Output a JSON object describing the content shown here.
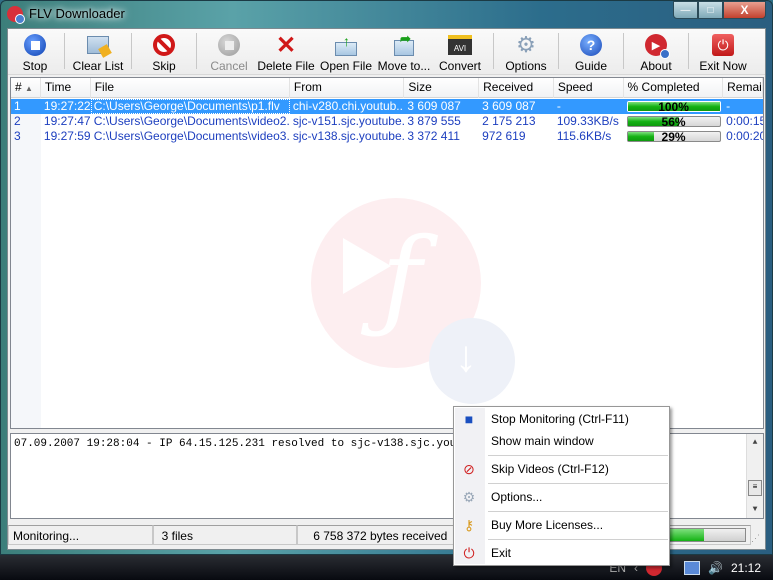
{
  "window": {
    "title": "FLV Downloader",
    "controls": {
      "minimize": "—",
      "maximize": "□",
      "close": "X"
    }
  },
  "toolbar": {
    "buttons": [
      {
        "label": "Stop",
        "icon": "stop-icon",
        "glyph": "■",
        "enabled": true
      },
      {
        "label": "Clear List",
        "icon": "clear-list-icon",
        "glyph": "☰",
        "enabled": true
      },
      {
        "label": "Skip",
        "icon": "skip-icon",
        "glyph": "⊘",
        "enabled": true
      },
      {
        "label": "Cancel",
        "icon": "cancel-icon",
        "glyph": "■",
        "enabled": false
      },
      {
        "label": "Delete File",
        "icon": "delete-file-icon",
        "glyph": "✖",
        "enabled": true
      },
      {
        "label": "Open File",
        "icon": "open-file-icon",
        "glyph": "↑",
        "enabled": true
      },
      {
        "label": "Move to...",
        "icon": "move-to-icon",
        "glyph": "↗",
        "enabled": true
      },
      {
        "label": "Convert",
        "icon": "convert-avi-icon",
        "glyph": "AVI",
        "enabled": true
      },
      {
        "label": "Options",
        "icon": "options-gear-icon",
        "glyph": "⚙",
        "enabled": true
      },
      {
        "label": "Guide",
        "icon": "help-icon",
        "glyph": "?",
        "enabled": true
      },
      {
        "label": "About",
        "icon": "about-flash-icon",
        "glyph": "▶",
        "enabled": true
      },
      {
        "label": "Exit Now",
        "icon": "power-icon",
        "glyph": "⏻",
        "enabled": true
      }
    ]
  },
  "downloads": {
    "columns": [
      "#",
      "Time",
      "File",
      "From",
      "Size",
      "Received",
      "Speed",
      "% Completed",
      "Remai"
    ],
    "sort_indicator": "▲",
    "rows": [
      {
        "num": "1",
        "time": "19:27:22",
        "file": "C:\\Users\\George\\Documents\\p1.flv",
        "from": "chi-v280.chi.youtub...",
        "size": "3 609 087",
        "received": "3 609 087",
        "speed": "-",
        "percent": 100,
        "percent_label": "100%",
        "remaining": "-",
        "selected": true
      },
      {
        "num": "2",
        "time": "19:27:47",
        "file": "C:\\Users\\George\\Documents\\video2....",
        "from": "sjc-v151.sjc.youtube...",
        "size": "3 879 555",
        "received": "2 175 213",
        "speed": "109.33KB/s",
        "percent": 56,
        "percent_label": "56%",
        "remaining": "0:00:15",
        "selected": false
      },
      {
        "num": "3",
        "time": "19:27:59",
        "file": "C:\\Users\\George\\Documents\\video3....",
        "from": "sjc-v138.sjc.youtube...",
        "size": "3 372 411",
        "received": "972 619",
        "speed": "115.6KB/s",
        "percent": 29,
        "percent_label": "29%",
        "remaining": "0:00:20",
        "selected": false
      }
    ]
  },
  "log": {
    "lines": [
      "07.09.2007 19:28:04 - IP 64.15.125.231 resolved to sjc-v138.sjc.youtube.com"
    ]
  },
  "statusbar": {
    "state": "Monitoring...",
    "files": "3 files",
    "bytes": "6 758 372 bytes received",
    "overall_progress": 0.75
  },
  "context_menu": {
    "items": [
      {
        "label": "Stop Monitoring (Ctrl-F11)",
        "icon": "stop-icon",
        "glyph": "■",
        "color": "#1a4fc0"
      },
      {
        "label": "Show main window",
        "icon": "",
        "glyph": "",
        "color": ""
      },
      {
        "label": "Skip Videos (Ctrl-F12)",
        "icon": "skip-icon",
        "glyph": "⊘",
        "color": "#d02020"
      },
      {
        "label": "Options...",
        "icon": "options-gear-icon",
        "glyph": "⚙",
        "color": "#9aa8b8"
      },
      {
        "label": "Buy More Licenses...",
        "icon": "key-icon",
        "glyph": "⚷",
        "color": "#d89a20"
      },
      {
        "label": "Exit",
        "icon": "power-icon",
        "glyph": "⏻",
        "color": "#d02020"
      }
    ]
  },
  "taskbar": {
    "language": "EN",
    "clock": "21:12"
  },
  "colors": {
    "selection": "#3399ff",
    "row_text": "#1d3fbf",
    "progress": "#14b214"
  }
}
